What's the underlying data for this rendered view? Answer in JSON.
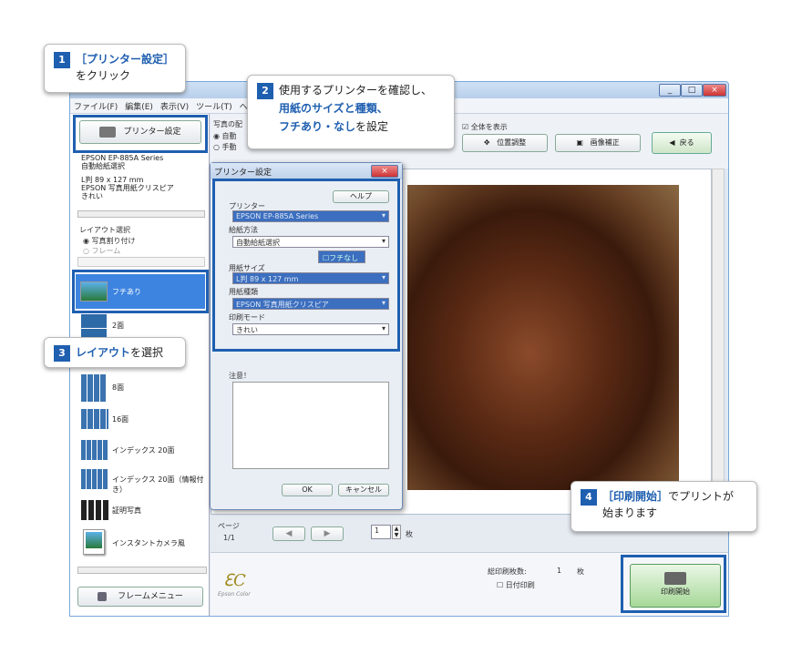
{
  "window": {
    "min": "_",
    "max": "□",
    "close": "×"
  },
  "menu": [
    "ファイル(F)",
    "編集(E)",
    "表示(V)",
    "ツール(T)",
    "ヘ"
  ],
  "left": {
    "printer_button": "プリンター設定",
    "printer_info": [
      "EPSON EP-885A Series",
      "自動給紙選択",
      "L判 89 x 127 mm",
      "EPSON 写真用紙クリスピア",
      "きれい"
    ],
    "layout_title": "レイアウト選択",
    "radio_photo": "写真割り付け",
    "radio_frame": "フレーム",
    "layouts": [
      "フチあり",
      "2面",
      "8面",
      "16面",
      "インデックス 20面",
      "インデックス 20面（情報付き）",
      "証明写真",
      "インスタントカメラ風"
    ],
    "frame_menu": "フレームメニュー"
  },
  "toolbar": {
    "photo_label": "写真の配",
    "radio_auto": "自動",
    "radio_manual": "手動",
    "show_all": "全体を表示",
    "position": "位置調整",
    "image_correct": "画像補正",
    "back": "戻る"
  },
  "dialog": {
    "title": "プリンター設定",
    "close": "×",
    "help": "ヘルプ",
    "printer_label": "プリンター",
    "printer_value": "EPSON EP-885A Series",
    "feed_label": "給紙方法",
    "feed_value": "自動給紙選択",
    "border_check": "フチなし",
    "size_label": "用紙サイズ",
    "size_value": "L判 89 x 127 mm",
    "type_label": "用紙種類",
    "type_value": "EPSON 写真用紙クリスピア",
    "mode_label": "印刷モード",
    "mode_value": "きれい",
    "notes_label": "注意！",
    "ok": "OK",
    "cancel": "キャンセル"
  },
  "bottom": {
    "page_label": "ページ",
    "page_value": "1/1",
    "copies": "1",
    "copies_unit": "枚",
    "total_label": "総印刷枚数:",
    "total_value": "1",
    "total_unit": "枚",
    "date_print": "日付印刷",
    "print_start": "印刷開始",
    "logo": "Epson Color"
  },
  "callouts": {
    "c1_num": "1",
    "c1_line1": "［プリンター設定］",
    "c1_line2": "をクリック",
    "c2_num": "2",
    "c2_line1": "使用するプリンターを確認し、",
    "c2_line2": "用紙のサイズと種類、",
    "c2_line3a": "フチあり・なし",
    "c2_line3b": "を設定",
    "c3_num": "3",
    "c3_a": "レイアウト",
    "c3_b": "を選択",
    "c4_num": "4",
    "c4_a": "［印刷開始］",
    "c4_b": "でプリントが",
    "c4_line2": "始まります"
  }
}
